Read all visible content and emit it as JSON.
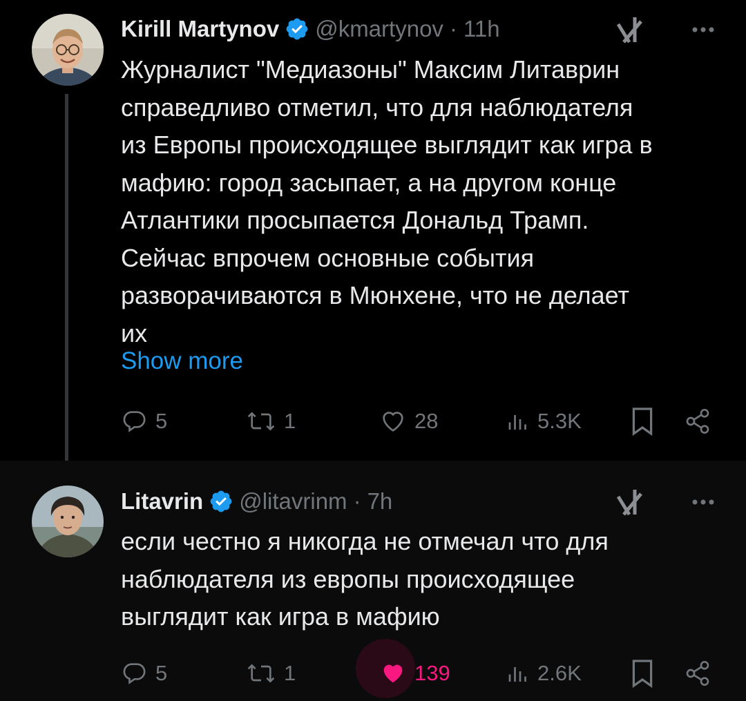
{
  "tweets": [
    {
      "author": {
        "name": "Kirill Martynov",
        "handle": "@kmartynov",
        "time": "11h",
        "verified": true
      },
      "text": "Журналист \"Медиазоны\" Максим Литаврин\nсправедливо отметил, что для наблюдателя\nиз Европы происходящее выглядит как игра в\nмафию: город засыпает, а на другом конце\nАтлантики просыпается Дональд Трамп.\nСейчас впрочем основные события\nразворачиваются в Мюнхене, что не делает\nих",
      "show_more": "Show more",
      "stats": {
        "replies": "5",
        "reposts": "1",
        "likes": "28",
        "views": "5.3K"
      },
      "liked": false
    },
    {
      "author": {
        "name": "Litavrin",
        "handle": "@litavrinm",
        "time": "7h",
        "verified": true
      },
      "text": "если честно я никогда не отмечал что для\nнаблюдателя из европы происходящее\nвыглядит как игра в мафию",
      "stats": {
        "replies": "5",
        "reposts": "1",
        "likes": "139",
        "views": "2.6K"
      },
      "liked": true
    }
  ],
  "separator": "·",
  "icons": [
    "verified-badge-icon",
    "grok-icon",
    "more-icon",
    "reply-icon",
    "repost-icon",
    "like-icon",
    "views-icon",
    "bookmark-icon",
    "share-icon"
  ],
  "colors": {
    "accent": "#1d9bf0",
    "like": "#f91880",
    "muted": "#71767b",
    "text": "#e7e9ea",
    "background": "#000000"
  }
}
